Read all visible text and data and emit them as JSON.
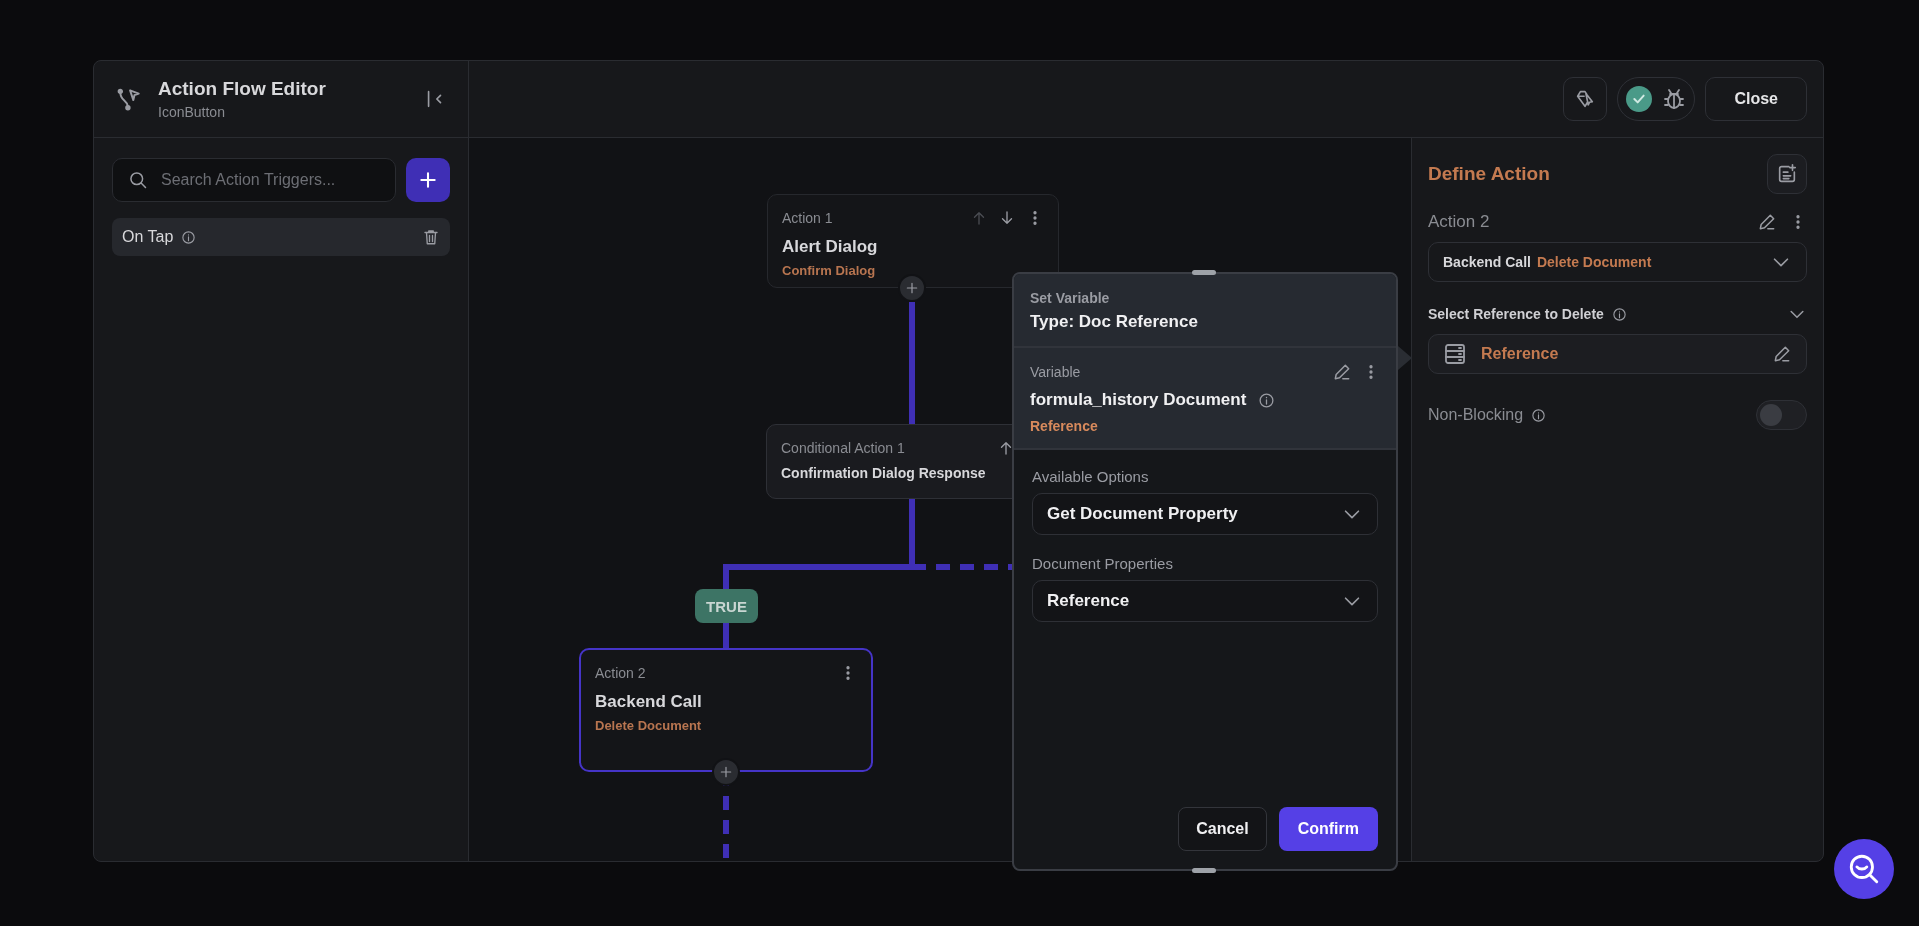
{
  "header": {
    "title": "Action Flow Editor",
    "subtitle": "IconButton"
  },
  "toolbar": {
    "close_label": "Close",
    "checks_passed": true
  },
  "triggers": {
    "search_placeholder": "Search Action Triggers...",
    "items": [
      {
        "label": "On Tap",
        "selected": true
      }
    ]
  },
  "canvas": {
    "nodes": [
      {
        "kind": "action",
        "step": "Action 1",
        "title": "Alert Dialog",
        "subtitle": "Confirm Dialog",
        "selected": false,
        "move_buttons": true
      },
      {
        "kind": "conditional",
        "step": "Conditional Action 1",
        "title": "Confirmation Dialog Response",
        "selected": false,
        "move_buttons": true
      },
      {
        "kind": "action",
        "step": "Action 2",
        "title": "Backend Call",
        "subtitle": "Delete Document",
        "selected": true,
        "move_buttons": false
      }
    ],
    "branch_label": "TRUE"
  },
  "popup": {
    "title": "Set Variable",
    "type_label": "Type: Doc Reference",
    "variable_label": "Variable",
    "variable_name": "formula_history Document",
    "variable_type": "Reference",
    "fields": [
      {
        "label": "Available Options",
        "value": "Get Document Property"
      },
      {
        "label": "Document Properties",
        "value": "Reference"
      }
    ],
    "cancel": "Cancel",
    "confirm": "Confirm"
  },
  "define_action": {
    "title": "Define Action",
    "step": "Action 2",
    "action_type": "Backend Call",
    "action_name": "Delete Document",
    "reference_section": "Select Reference to Delete",
    "reference_value": "Reference",
    "non_blocking_label": "Non-Blocking",
    "non_blocking_on": false
  }
}
